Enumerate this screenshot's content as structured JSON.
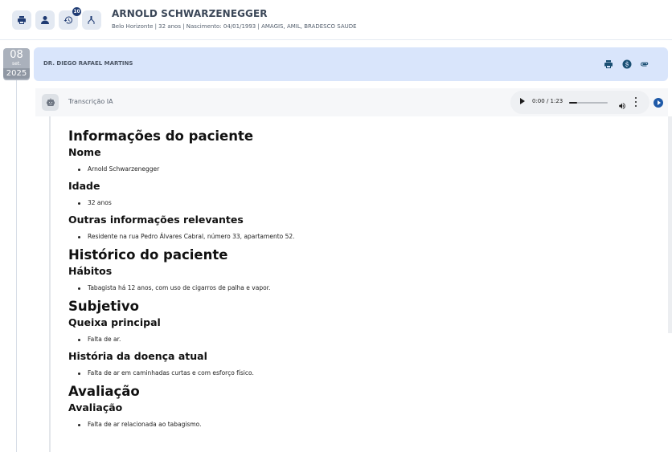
{
  "toolbar": {
    "history_badge": "10",
    "icons": [
      "printer-icon",
      "person-icon",
      "history-icon",
      "merge-icon"
    ]
  },
  "patient": {
    "name": "ARNOLD SCHWARZENEGGER",
    "info": "Belo Horizonte | 32 anos | Nascimento: 04/01/1993 | AMAGIS, AMIL, BRADESCO SAUDE"
  },
  "entry": {
    "date_day": "08",
    "date_month": "set.",
    "date_year": "2025",
    "doctor": "DR. DIEGO RAFAEL MARTINS"
  },
  "transcription": {
    "label": "Transcrição IA",
    "time": "0:00 / 1:23",
    "progress": 0.2
  },
  "document": [
    {
      "type": "h1",
      "text": "Informações do paciente"
    },
    {
      "type": "h2",
      "text": "Nome"
    },
    {
      "type": "li",
      "text": "Arnold Schwarzenegger"
    },
    {
      "type": "h2",
      "text": "Idade"
    },
    {
      "type": "li",
      "text": "32 anos"
    },
    {
      "type": "h2",
      "text": "Outras informações relevantes"
    },
    {
      "type": "li",
      "text": "Residente na rua Pedro Álvares Cabral, número 33, apartamento 52."
    },
    {
      "type": "h1",
      "text": "Histórico do paciente"
    },
    {
      "type": "h2",
      "text": "Hábitos"
    },
    {
      "type": "li",
      "text": "Tabagista há 12 anos, com uso de cigarros de palha e vapor."
    },
    {
      "type": "h1",
      "text": "Subjetivo"
    },
    {
      "type": "h2",
      "text": "Queixa principal"
    },
    {
      "type": "li",
      "text": "Falta de ar."
    },
    {
      "type": "h2",
      "text": "História da doença atual"
    },
    {
      "type": "li",
      "text": "Falta de ar em caminhadas curtas e com esforço físico."
    },
    {
      "type": "h1",
      "text": "Avaliação"
    },
    {
      "type": "h2",
      "text": "Avaliação"
    },
    {
      "type": "li",
      "text": "Falta de ar relacionada ao tabagismo."
    }
  ],
  "colors": {
    "accent": "#1f3b73",
    "doctor_bar": "#d9e5fb",
    "doctor_icons": "#1a4f73",
    "play_button": "#1f5aa8"
  }
}
